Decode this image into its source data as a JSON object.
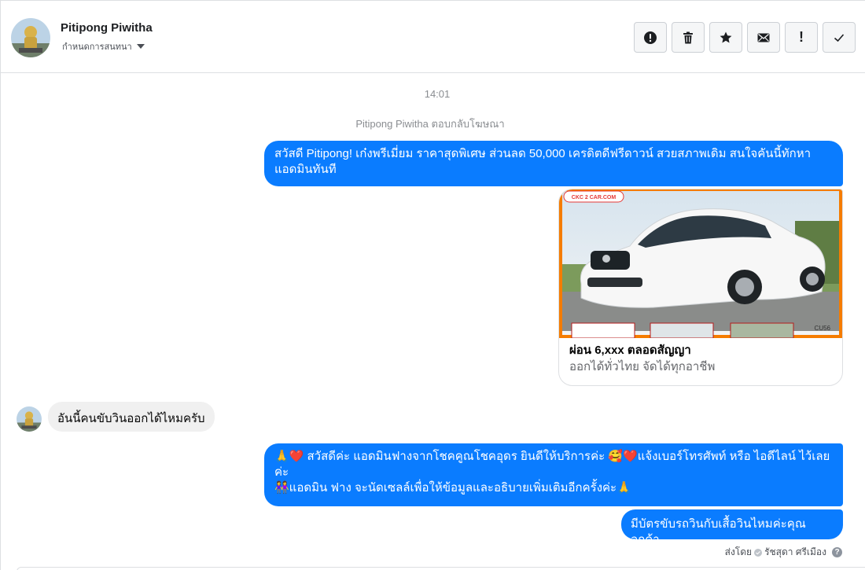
{
  "conversation": {
    "name": "Pitipong Piwitha",
    "assign_label": "กำหนดการสนทนา"
  },
  "toolbar": {
    "buttons": [
      "spam",
      "delete",
      "star",
      "mark-unread",
      "important",
      "done"
    ],
    "important_glyph": "!"
  },
  "thread": {
    "time": "14:01",
    "reply_note": "Pitipong Piwitha ตอบกลับโฆษณา",
    "ad_message": "สวัสดี Pitipong! เก๋งพรีเมี่ยม ราคาสุดพิเศษ ส่วนลด 50,000 เครดิตดีฟรีดาวน์ สวยสภาพเดิม สนใจคันนี้ทักหา แอดมินทันที",
    "attachment": {
      "title": "ผ่อน 6,xxx ตลอดสัญญา",
      "description": "ออกได้ทั่วไทย จัดได้ทุกอาชีพ",
      "image_logo_text": "CKC 2 CAR.COM",
      "image_code": "CU56"
    },
    "incoming_message": "อันนี้คนขับวินออกได้ไหมครับ",
    "reply_lines": [
      "🙏❤️ สวัสดีค่ะ แอดมินฟางจากโชคคูณโชคอุดร ยินดีให้บริการค่ะ 🥰❤️แจ้งเบอร์โทรศัพท์ หรือ ไอดีไลน์ ไว้เลยค่ะ",
      "👭แอดมิน ฟาง จะนัดเซลล์เพื่อให้ข้อมูลและอธิบายเพิ่มเติมอีกครั้งค่ะ🙏"
    ],
    "last_message": "มีบัตรขับรถวินกับเสื้อวินไหมค่ะคุณลูกค้า",
    "sent_by_label": "ส่งโดย",
    "sent_by_name": "รัชสุดา ศรีเมือง",
    "info_glyph": "?"
  },
  "colors": {
    "outgoing_bubble": "#0a7cff",
    "incoming_bubble": "#f0f0f0",
    "meta_text": "#8a8d91"
  }
}
